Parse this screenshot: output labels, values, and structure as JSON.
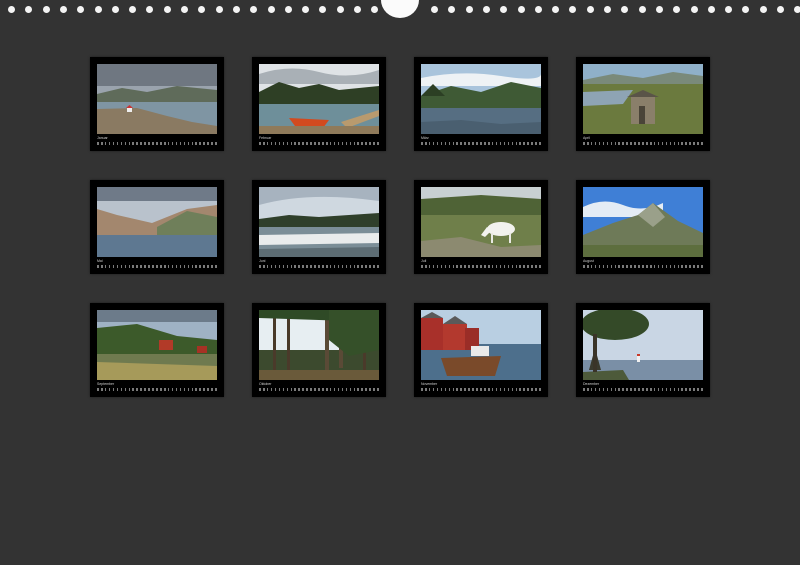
{
  "calendar": {
    "background_color": "#333333",
    "binding_hole_count": 44,
    "months": [
      {
        "label": "Januar",
        "scene": "coast-with-white-hut"
      },
      {
        "label": "Februar",
        "scene": "red-boat-at-lake"
      },
      {
        "label": "März",
        "scene": "river-in-valley"
      },
      {
        "label": "April",
        "scene": "wooden-hut-on-moor"
      },
      {
        "label": "Mai",
        "scene": "mountains-at-fjord"
      },
      {
        "label": "Juni",
        "scene": "river-rapids"
      },
      {
        "label": "Juli",
        "scene": "white-reindeer-grazing"
      },
      {
        "label": "August",
        "scene": "mountain-peak-blue-sky"
      },
      {
        "label": "September",
        "scene": "red-houses-at-lake"
      },
      {
        "label": "Oktober",
        "scene": "pine-forest"
      },
      {
        "label": "November",
        "scene": "red-harbour-houses-with-boat"
      },
      {
        "label": "Dezember",
        "scene": "tree-and-lighthouse-at-sea"
      }
    ]
  }
}
